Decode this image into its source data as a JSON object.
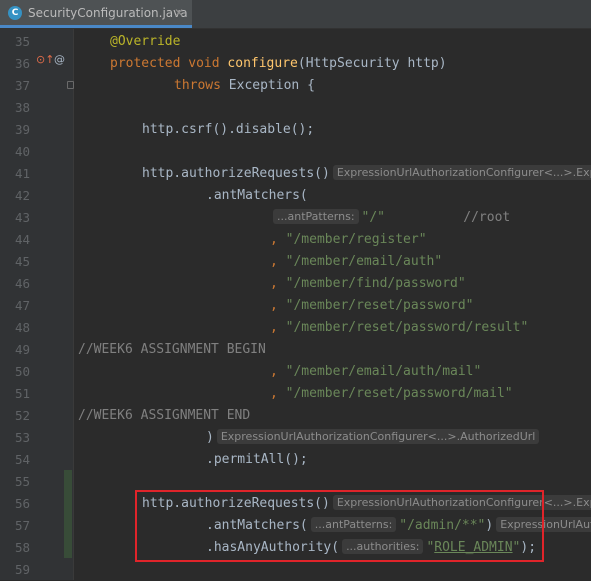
{
  "tab": {
    "icon_letter": "C",
    "filename": "SecurityConfiguration.java",
    "close": "✕"
  },
  "gutter_icons": {
    "override_icon": "implementing-method-icon",
    "annotation_icon": "@"
  },
  "lines": [
    {
      "n": "35",
      "segs": [
        [
          "ann",
          "@Override"
        ]
      ],
      "indent": 32
    },
    {
      "n": "36",
      "segs": [
        [
          "kw",
          "protected "
        ],
        [
          "kw",
          "void "
        ],
        [
          "meth",
          "configure"
        ],
        [
          "",
          "(HttpSecurity http)"
        ]
      ],
      "indent": 32
    },
    {
      "n": "37",
      "segs": [
        [
          "kw",
          "throws "
        ],
        [
          "",
          "Exception {"
        ]
      ],
      "indent": 96
    },
    {
      "n": "38",
      "segs": [],
      "indent": 0
    },
    {
      "n": "39",
      "segs": [
        [
          "",
          "http.csrf().disable();"
        ]
      ],
      "indent": 64
    },
    {
      "n": "40",
      "segs": [],
      "indent": 0
    },
    {
      "n": "41",
      "segs": [
        [
          "",
          "http.authorizeRequests()"
        ],
        [
          "hint",
          "ExpressionUrlAuthorizationConfigurer<...>.Exp"
        ]
      ],
      "indent": 64
    },
    {
      "n": "42",
      "segs": [
        [
          "",
          ".antMatchers("
        ]
      ],
      "indent": 128
    },
    {
      "n": "43",
      "segs": [
        [
          "hint",
          "...antPatterns:"
        ],
        [
          "str",
          "\"/\""
        ],
        [
          "cmt",
          "          //root"
        ]
      ],
      "indent": 192
    },
    {
      "n": "44",
      "segs": [
        [
          "kw",
          ", "
        ],
        [
          "str",
          "\"/member/register\""
        ]
      ],
      "indent": 192
    },
    {
      "n": "45",
      "segs": [
        [
          "kw",
          ", "
        ],
        [
          "str",
          "\"/member/email/auth\""
        ]
      ],
      "indent": 192
    },
    {
      "n": "46",
      "segs": [
        [
          "kw",
          ", "
        ],
        [
          "str",
          "\"/member/find/password\""
        ]
      ],
      "indent": 192
    },
    {
      "n": "47",
      "segs": [
        [
          "kw",
          ", "
        ],
        [
          "str",
          "\"/member/reset/password\""
        ]
      ],
      "indent": 192
    },
    {
      "n": "48",
      "segs": [
        [
          "kw",
          ", "
        ],
        [
          "str",
          "\"/member/reset/password/result\""
        ]
      ],
      "indent": 192
    },
    {
      "n": "49",
      "segs": [
        [
          "cmt",
          "//WEEK6 ASSIGNMENT BEGIN"
        ]
      ],
      "indent": 0
    },
    {
      "n": "50",
      "segs": [
        [
          "kw",
          ", "
        ],
        [
          "str",
          "\"/member/email/auth/mail\""
        ]
      ],
      "indent": 192
    },
    {
      "n": "51",
      "segs": [
        [
          "kw",
          ", "
        ],
        [
          "str",
          "\"/member/reset/password/mail\""
        ]
      ],
      "indent": 192
    },
    {
      "n": "52",
      "segs": [
        [
          "cmt",
          "//WEEK6 ASSIGNMENT END"
        ]
      ],
      "indent": 0
    },
    {
      "n": "53",
      "segs": [
        [
          "",
          ")"
        ],
        [
          "hint",
          "ExpressionUrlAuthorizationConfigurer<...>.AuthorizedUrl"
        ]
      ],
      "indent": 128
    },
    {
      "n": "54",
      "segs": [
        [
          "",
          ".permitAll();"
        ]
      ],
      "indent": 128
    },
    {
      "n": "55",
      "segs": [],
      "indent": 0
    },
    {
      "n": "56",
      "segs": [
        [
          "",
          "http.authorizeRequests()"
        ],
        [
          "hint",
          "ExpressionUrlAuthorizationConfigurer<...>.Exp"
        ]
      ],
      "indent": 64
    },
    {
      "n": "57",
      "segs": [
        [
          "",
          ".antMatchers("
        ],
        [
          "hint",
          "...antPatterns:"
        ],
        [
          "str",
          "\"/admin/**\""
        ],
        [
          "",
          ")"
        ],
        [
          "hint",
          "ExpressionUrlAut"
        ]
      ],
      "indent": 128
    },
    {
      "n": "58",
      "segs": [
        [
          "",
          ".hasAnyAuthority("
        ],
        [
          "hint",
          "...authorities:"
        ],
        [
          "str",
          "\""
        ],
        [
          "str under",
          "ROLE_ADMIN"
        ],
        [
          "str",
          "\""
        ],
        [
          "",
          ");"
        ]
      ],
      "indent": 128
    },
    {
      "n": "59",
      "segs": [],
      "indent": 0
    }
  ]
}
